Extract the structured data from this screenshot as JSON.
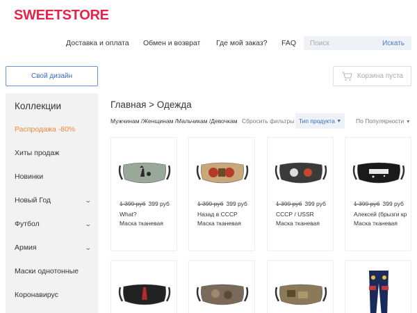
{
  "brand": "SWEETSTORE",
  "nav": [
    "Доставка и оплата",
    "Обмен и возврат",
    "Где мой заказ?",
    "FAQ"
  ],
  "search": {
    "placeholder": "Поиск",
    "button": "Искать"
  },
  "design_button": "Свой дизайн",
  "cart": "Корзина пуста",
  "sidebar": {
    "title": "Коллекции",
    "items": [
      {
        "label": "Распродажа -80%"
      },
      {
        "label": "Хиты продаж"
      },
      {
        "label": "Новинки"
      },
      {
        "label": "Новый Год"
      },
      {
        "label": "Футбол"
      },
      {
        "label": "Армия"
      },
      {
        "label": "Маски однотонные"
      },
      {
        "label": "Коронавирус"
      }
    ]
  },
  "breadcrumb": "Главная > Одежда",
  "filters": {
    "gender": "Мужчинам /Женщинам /Мальчикам /Девочкам",
    "reset": "Сбросить фильтры",
    "product_type": "Тип продукта",
    "sort": "По Популярности"
  },
  "products": [
    {
      "old_price": "1 399 руб",
      "price": "399 руб",
      "name": "What?",
      "type": "Маска тканевая"
    },
    {
      "old_price": "1 399 руб",
      "price": "399 руб",
      "name": "Назад в СССР",
      "type": "Маска тканевая"
    },
    {
      "old_price": "1 399 руб",
      "price": "399 руб",
      "name": "СССР / USSR",
      "type": "Маска тканевая"
    },
    {
      "old_price": "1 399 руб",
      "price": "399 руб",
      "name": "Алексей (брызги кр",
      "type": "Маска тканевая"
    }
  ],
  "colors": {
    "brand": "#e8234a",
    "sale": "#f0883a",
    "accent": "#3a6ac0"
  }
}
